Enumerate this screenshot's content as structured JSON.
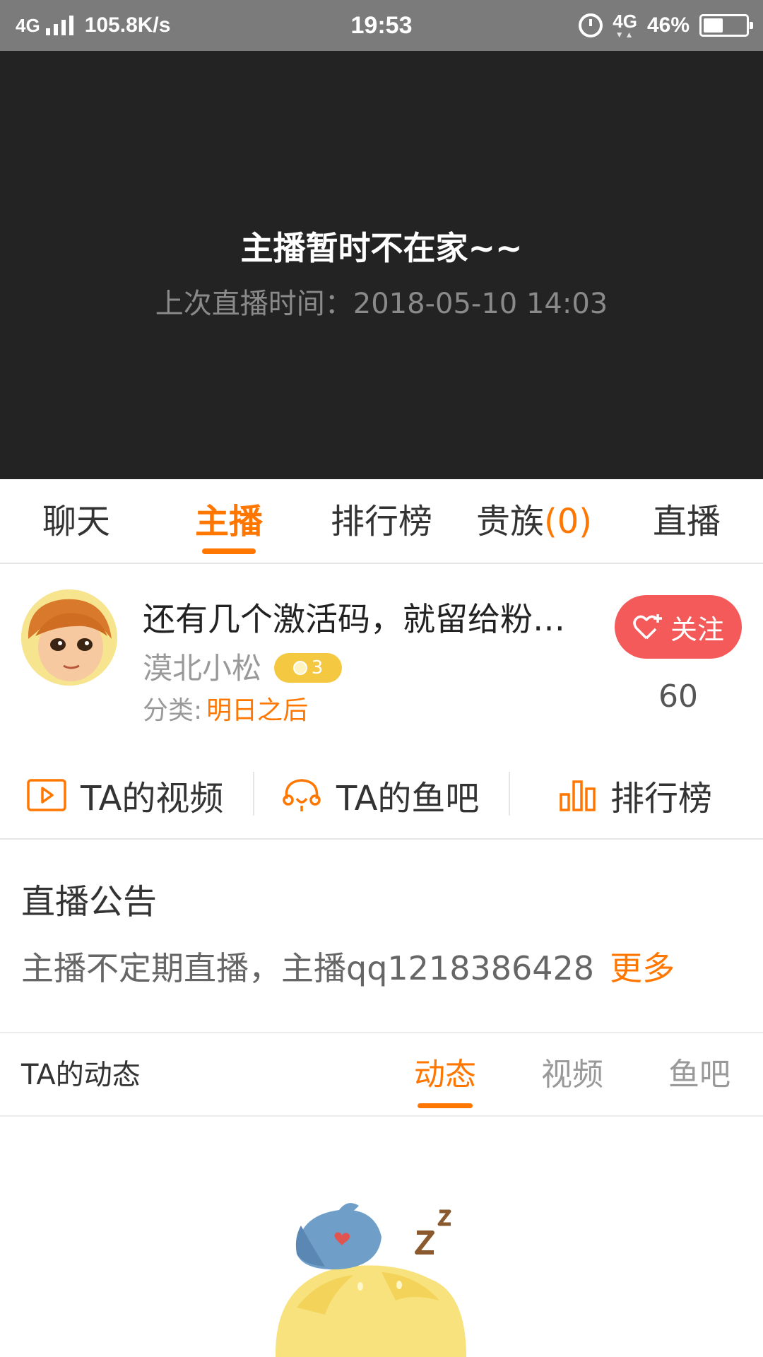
{
  "status_bar": {
    "network": "4G",
    "speed": "105.8K/s",
    "time": "19:53",
    "network_right": "4G",
    "battery": "46%",
    "battery_level": 0.46
  },
  "player": {
    "offline_title": "主播暂时不在家~~",
    "last_live": "上次直播时间：2018-05-10  14:03"
  },
  "tabs": {
    "chat": "聊天",
    "anchor": "主播",
    "ranking": "排行榜",
    "noble": "贵族",
    "noble_count": "(0)",
    "live": "直播",
    "active": "主播"
  },
  "anchor": {
    "title": "还有几个激活码，就留给粉…",
    "name": "漠北小松",
    "level": "3",
    "category_label": "分类:",
    "category_value": "明日之后",
    "follow_label": "关注",
    "follow_count": "60"
  },
  "quick_links": {
    "videos": "TA的视频",
    "fishbar": "TA的鱼吧",
    "ranking": "排行榜"
  },
  "notice": {
    "title": "直播公告",
    "body": "主播不定期直播，主播qq1218386428",
    "more": "更多"
  },
  "activity": {
    "title": "TA的动态",
    "tabs": [
      "动态",
      "视频",
      "鱼吧"
    ],
    "active": "动态"
  },
  "colors": {
    "accent": "#ff7700",
    "follow_button": "#f45a5a",
    "player_bg": "#232323",
    "status_bar": "#7b7b7b"
  }
}
